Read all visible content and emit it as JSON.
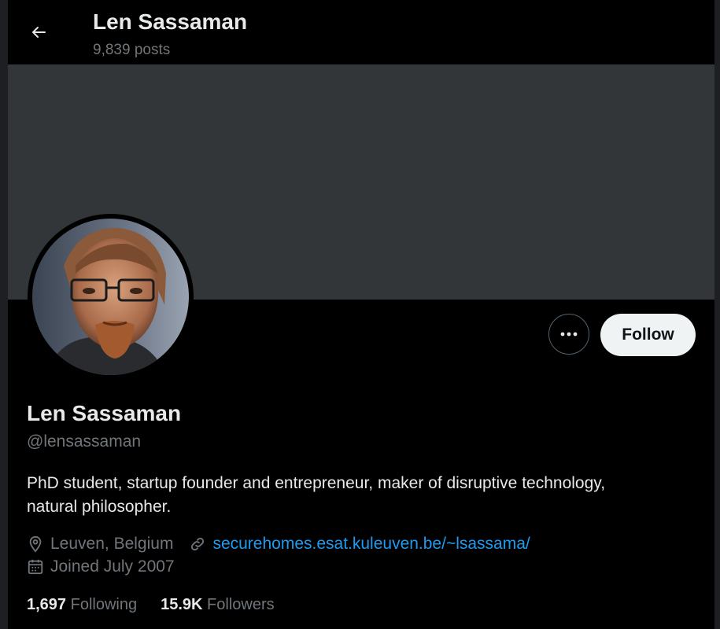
{
  "header": {
    "name": "Len Sassaman",
    "posts": "9,839 posts",
    "back_icon": "arrow-left-icon"
  },
  "colors": {
    "background": "#000000",
    "banner": "#333639",
    "text_primary": "#e7e9ea",
    "text_secondary": "#71767b",
    "link": "#1d9bf0",
    "follow_button_bg": "#eff3f4"
  },
  "actions": {
    "more_icon": "ellipsis-icon",
    "follow_label": "Follow"
  },
  "profile": {
    "display_name": "Len Sassaman",
    "handle": "@lensassaman",
    "bio_line1": "PhD student, startup founder and entrepreneur, maker of disruptive technology,",
    "bio_line2": "natural philosopher.",
    "location": "Leuven, Belgium",
    "location_icon": "location-pin-icon",
    "website": "securehomes.esat.kuleuven.be/~lsassama/",
    "website_icon": "link-icon",
    "joined": "Joined July 2007",
    "joined_icon": "calendar-icon"
  },
  "stats": {
    "following_count": "1,697",
    "following_label": "Following",
    "followers_count": "15.9K",
    "followers_label": "Followers"
  }
}
